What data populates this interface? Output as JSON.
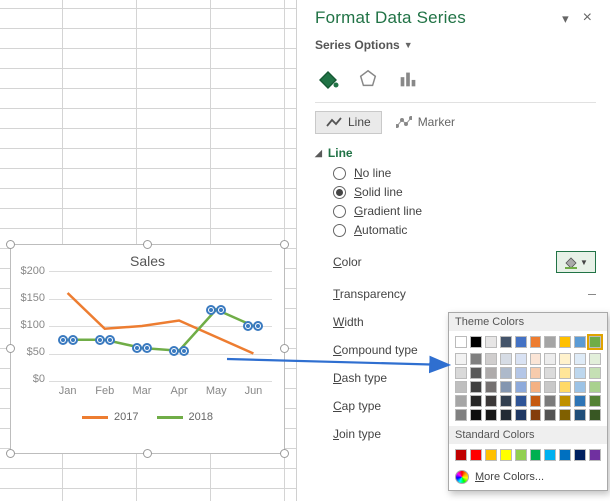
{
  "pane": {
    "title": "Format Data Series",
    "series_options": "Series Options",
    "tabs": {
      "line": "Line",
      "marker": "Marker"
    },
    "section": "Line",
    "radios": {
      "no_line_pre": "N",
      "no_line_post": "o line",
      "solid_pre": "S",
      "solid_post": "olid line",
      "gradient_pre": "G",
      "gradient_post": "radient line",
      "automatic_pre": "A",
      "automatic_post": "utomatic"
    },
    "props": {
      "color_pre": "C",
      "color_post": "olor",
      "transparency_pre": "T",
      "transparency_post": "ransparency",
      "width_pre": "W",
      "width_post": "idth",
      "compound_pre": "C",
      "compound_post": "ompound type",
      "dash_pre": "D",
      "dash_post": "ash type",
      "cap_pre": "C",
      "cap_post": "ap type",
      "join_pre": "J",
      "join_post": "oin type"
    }
  },
  "picker": {
    "theme_label": "Theme Colors",
    "standard_label": "Standard Colors",
    "more_pre": "M",
    "more_post": "ore Colors...",
    "theme_top": [
      "#ffffff",
      "#000000",
      "#e7e6e6",
      "#44546a",
      "#4472c4",
      "#ed7d31",
      "#a5a5a5",
      "#ffc000",
      "#5b9bd5",
      "#70ad47"
    ],
    "theme_shades": [
      [
        "#f2f2f2",
        "#7f7f7f",
        "#d0cece",
        "#d6dce5",
        "#d9e2f3",
        "#fbe5d6",
        "#ededed",
        "#fff2cc",
        "#deebf7",
        "#e2efda"
      ],
      [
        "#d9d9d9",
        "#595959",
        "#aeabab",
        "#adb9ca",
        "#b4c6e7",
        "#f7cbac",
        "#dbdbdb",
        "#ffe699",
        "#bdd7ee",
        "#c5e0b4"
      ],
      [
        "#bfbfbf",
        "#404040",
        "#757171",
        "#8496b0",
        "#8eaadb",
        "#f4b183",
        "#c9c9c9",
        "#ffd966",
        "#9cc3e6",
        "#a9d18e"
      ],
      [
        "#a6a6a6",
        "#262626",
        "#3b3838",
        "#323f4f",
        "#2f5496",
        "#c55a11",
        "#7b7b7b",
        "#bf9000",
        "#2e75b6",
        "#548235"
      ],
      [
        "#808080",
        "#0d0d0d",
        "#171717",
        "#222a35",
        "#1f3864",
        "#843c0c",
        "#525252",
        "#806000",
        "#1f4e79",
        "#385723"
      ]
    ],
    "standard": [
      "#c00000",
      "#ff0000",
      "#ffc000",
      "#ffff00",
      "#92d050",
      "#00b050",
      "#00b0f0",
      "#0070c0",
      "#002060",
      "#7030a0"
    ]
  },
  "chart_data": {
    "type": "line",
    "title": "Sales",
    "categories": [
      "Jan",
      "Feb",
      "Mar",
      "Apr",
      "May",
      "Jun"
    ],
    "series": [
      {
        "name": "2017",
        "color": "#ed7d31",
        "values": [
          160,
          95,
          100,
          110,
          80,
          50
        ]
      },
      {
        "name": "2018",
        "color": "#70ad47",
        "values": [
          75,
          75,
          60,
          55,
          130,
          100
        ],
        "selected": true
      }
    ],
    "ylim": [
      0,
      200
    ],
    "yticks": [
      0,
      50,
      100,
      150,
      200
    ],
    "ylabel_prefix": "$"
  }
}
